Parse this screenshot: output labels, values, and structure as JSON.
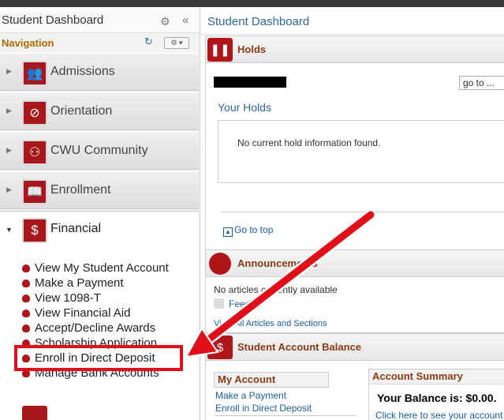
{
  "sidebar": {
    "title": "Student Dashboard",
    "nav_label": "Navigation",
    "folders": [
      {
        "label": "Admissions"
      },
      {
        "label": "Orientation"
      },
      {
        "label": "CWU Community"
      },
      {
        "label": "Enrollment"
      }
    ],
    "financial": {
      "label": "Financial",
      "items": [
        {
          "label": "View My Student Account"
        },
        {
          "label": "Make a Payment"
        },
        {
          "label": "View 1098-T"
        },
        {
          "label": "View Financial Aid"
        },
        {
          "label": "Accept/Decline Awards"
        },
        {
          "label": "Scholarship Application"
        },
        {
          "label": "Enroll in Direct Deposit"
        },
        {
          "label": "Manage Bank Accounts"
        }
      ]
    }
  },
  "main": {
    "title": "Student Dashboard",
    "holds": {
      "title": "Holds",
      "goto": "go to ...",
      "your_holds": "Your Holds",
      "no_hold": "No current hold information found.",
      "goto_top": "Go to top"
    },
    "announcements": {
      "title": "Announcements",
      "no_articles": "No articles currently available",
      "feed": "Feed",
      "view_all": "View All Articles and Sections"
    },
    "balance": {
      "title": "Student Account Balance",
      "my_account": "My Account",
      "link_payment": "Make a Payment",
      "link_deposit": "Enroll in Direct Deposit",
      "summary_title": "Account Summary",
      "balance_text": "Your Balance is: $0.00.",
      "balance_link": "Click here to see your account"
    }
  },
  "colors": {
    "brand_red": "#b0151a",
    "annotation_red": "#e0101a",
    "link_blue": "#1a5da6"
  }
}
